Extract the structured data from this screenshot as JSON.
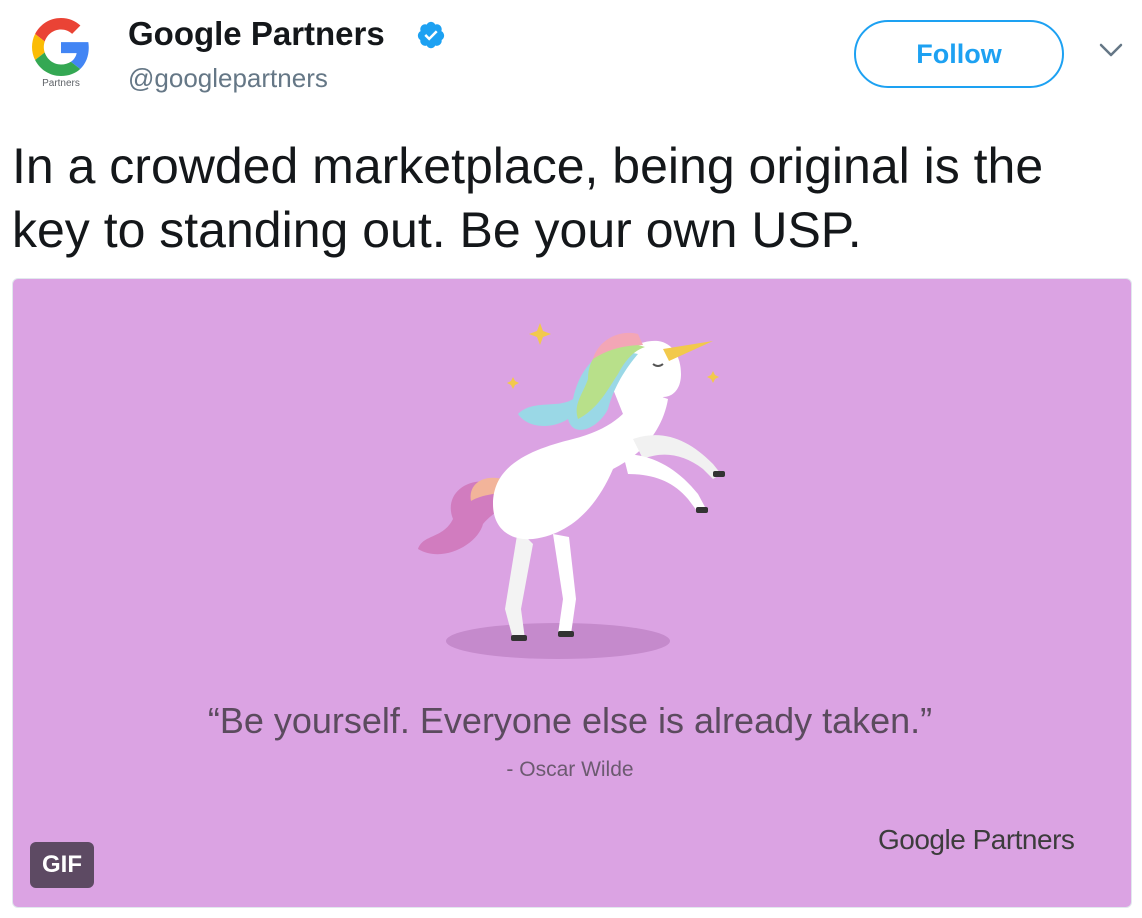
{
  "account": {
    "name": "Google Partners",
    "handle": "@googlepartners",
    "avatar_caption": "Partners",
    "verified": true
  },
  "actions": {
    "follow_label": "Follow",
    "menu_icon": "chevron-down-icon"
  },
  "tweet": {
    "text": "In a crowded marketplace, being original is the key to standing out. Be your own USP."
  },
  "media": {
    "background_color": "#dba3e3",
    "quote": "“Be yourself. Everyone else is already taken.”",
    "author": "- Oscar Wilde",
    "brand": "Google Partners",
    "badge": "GIF"
  },
  "colors": {
    "accent": "#1da1f2",
    "text": "#14171a",
    "secondary_text": "#657786"
  }
}
